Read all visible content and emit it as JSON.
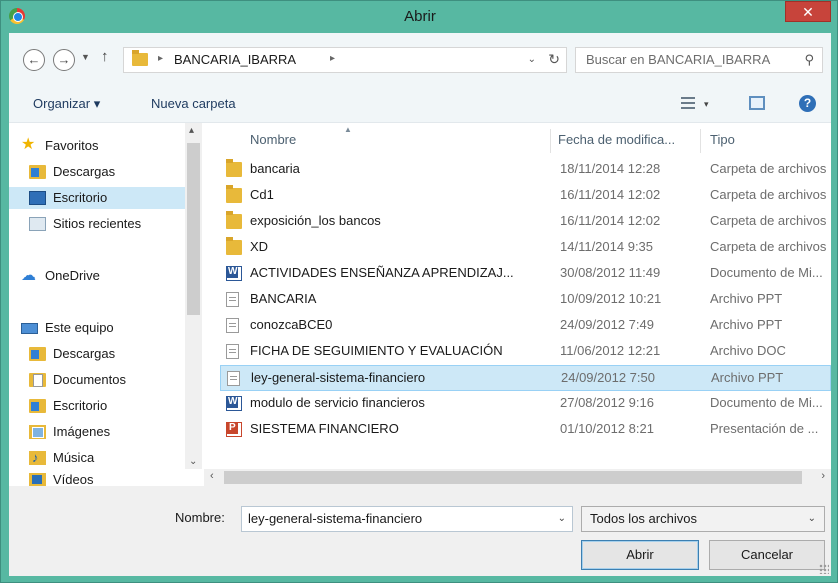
{
  "window": {
    "title": "Abrir",
    "close_glyph": "✕"
  },
  "address_bar": {
    "back_glyph": "←",
    "forward_glyph": "→",
    "up_glyph": "↑",
    "separator": "▸",
    "path": "BANCARIA_IBARRA",
    "dropdown_glyph": "⌄",
    "refresh_glyph": "↻"
  },
  "search": {
    "placeholder": "Buscar en BANCARIA_IBARRA",
    "icon_glyph": "⚲"
  },
  "toolbar": {
    "organize": "Organizar ▾",
    "new_folder": "Nueva carpeta",
    "view_dd": "▾",
    "help": "?"
  },
  "nav": {
    "favorites": "Favoritos",
    "downloads": "Descargas",
    "desktop": "Escritorio",
    "recent": "Sitios recientes",
    "onedrive": "OneDrive",
    "this_pc": "Este equipo",
    "pc_downloads": "Descargas",
    "pc_documents": "Documentos",
    "pc_desktop": "Escritorio",
    "pc_images": "Imágenes",
    "pc_music": "Música",
    "pc_videos": "Vídeos",
    "scroll_up": "▴",
    "scroll_down": "⌄"
  },
  "columns": {
    "name": "Nombre",
    "date": "Fecha de modifica...",
    "type": "Tipo"
  },
  "files": [
    {
      "name": "bancaria",
      "date": "18/11/2014 12:28",
      "type": "Carpeta de archivos",
      "icon": "folder-icon"
    },
    {
      "name": "Cd1",
      "date": "16/11/2014 12:02",
      "type": "Carpeta de archivos",
      "icon": "folder-icon"
    },
    {
      "name": "exposición_los bancos",
      "date": "16/11/2014 12:02",
      "type": "Carpeta de archivos",
      "icon": "folder-icon"
    },
    {
      "name": "XD",
      "date": "14/11/2014 9:35",
      "type": "Carpeta de archivos",
      "icon": "folder-icon"
    },
    {
      "name": "ACTIVIDADES ENSEÑANZA APRENDIZAJ...",
      "date": "30/08/2012 11:49",
      "type": "Documento de Mi...",
      "icon": "word-doc-icon"
    },
    {
      "name": "BANCARIA",
      "date": "10/09/2012 10:21",
      "type": "Archivo PPT",
      "icon": "file-icon"
    },
    {
      "name": "conozcaBCE0",
      "date": "24/09/2012 7:49",
      "type": "Archivo PPT",
      "icon": "file-icon"
    },
    {
      "name": "FICHA DE SEGUIMIENTO Y EVALUACIÓN",
      "date": "11/06/2012 12:21",
      "type": "Archivo DOC",
      "icon": "file-icon"
    },
    {
      "name": "ley-general-sistema-financiero",
      "date": "24/09/2012 7:50",
      "type": "Archivo PPT",
      "icon": "file-icon"
    },
    {
      "name": "modulo de servicio financieros",
      "date": "27/08/2012 9:16",
      "type": "Documento de Mi...",
      "icon": "word-doc-icon"
    },
    {
      "name": "SIESTEMA FINANCIERO",
      "date": "01/10/2012 8:21",
      "type": "Presentación de ...",
      "icon": "powerpoint-icon"
    }
  ],
  "selected_file": "ley-general-sistema-financiero",
  "hscroll": {
    "left": "‹",
    "right": "›"
  },
  "footer": {
    "filename_label": "Nombre:",
    "filename_value": "ley-general-sistema-financiero",
    "filter_value": "Todos los archivos",
    "dd_glyph": "⌄",
    "open_button": "Abrir",
    "cancel_button": "Cancelar"
  },
  "colors": {
    "frame": "#57b8a2",
    "selection": "#cde8f7",
    "close_button": "#c7443b"
  }
}
